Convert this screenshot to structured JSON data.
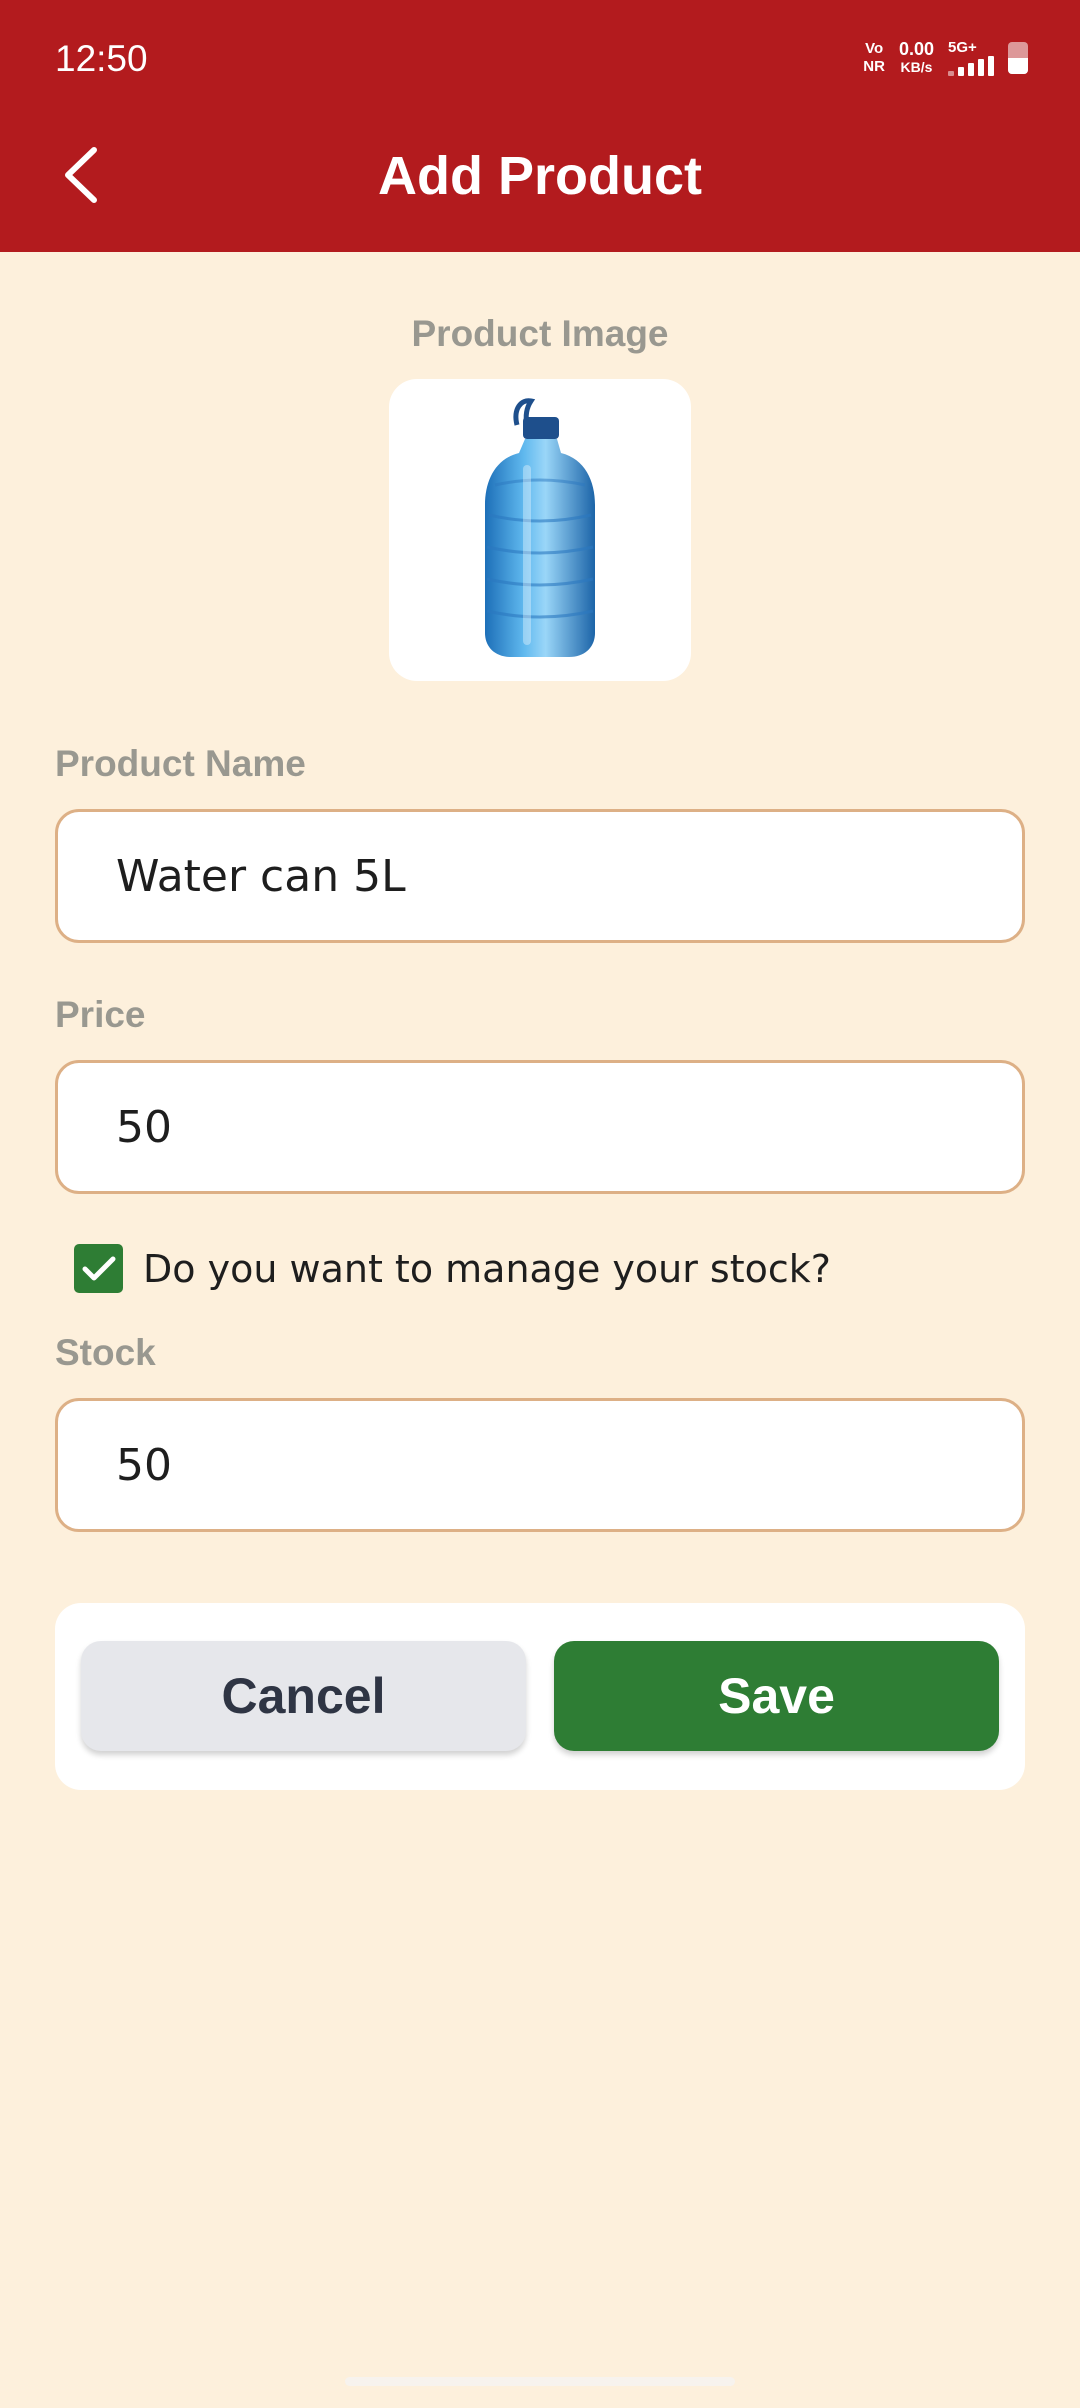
{
  "status_bar": {
    "time": "12:50",
    "vonr_top": "Vo",
    "vonr_bottom": "NR",
    "net_speed": "0.00",
    "net_unit": "KB/s",
    "network_type": "5G+",
    "signal_icon": "signal-bars-icon",
    "battery_icon": "battery-icon"
  },
  "header": {
    "title": "Add Product",
    "back_icon": "chevron-left-icon"
  },
  "product_image": {
    "label": "Product Image",
    "image_icon": "water-bottle-image"
  },
  "product_name": {
    "label": "Product Name",
    "value": "Water can 5L"
  },
  "price": {
    "label": "Price",
    "value": "50"
  },
  "manage_stock": {
    "label": "Do you want to manage your stock?",
    "checked": true
  },
  "stock": {
    "label": "Stock",
    "value": "50"
  },
  "actions": {
    "cancel_label": "Cancel",
    "save_label": "Save"
  },
  "colors": {
    "header_bg": "#B31B1E",
    "page_bg": "#FDF0DC",
    "input_border": "#DDB086",
    "accent_green": "#2E7D34",
    "label_gray": "#999890"
  }
}
